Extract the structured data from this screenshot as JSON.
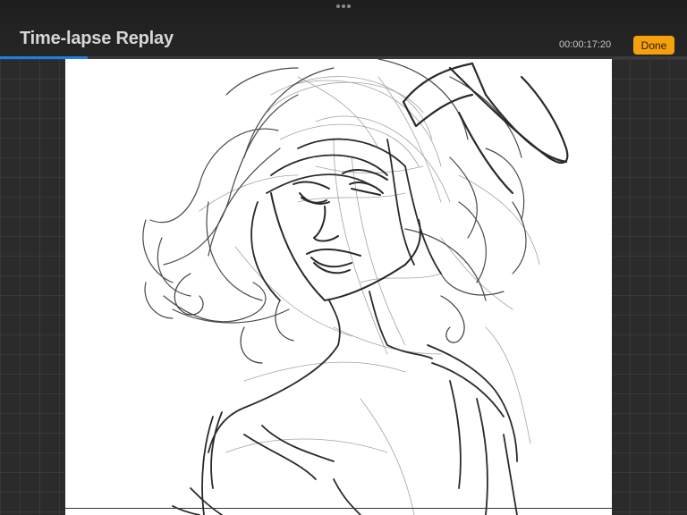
{
  "header": {
    "title": "Time-lapse Replay",
    "elapsed_time": "00:00:17:20",
    "done_label": "Done",
    "more_icon": "ellipsis-icon"
  },
  "playback": {
    "progress_fraction": 0.127
  },
  "colors": {
    "accent_button": "#f5a00c",
    "progress": "#1f7ee6",
    "canvas": "#ffffff",
    "sketch_ink": "#2a2a2a"
  }
}
